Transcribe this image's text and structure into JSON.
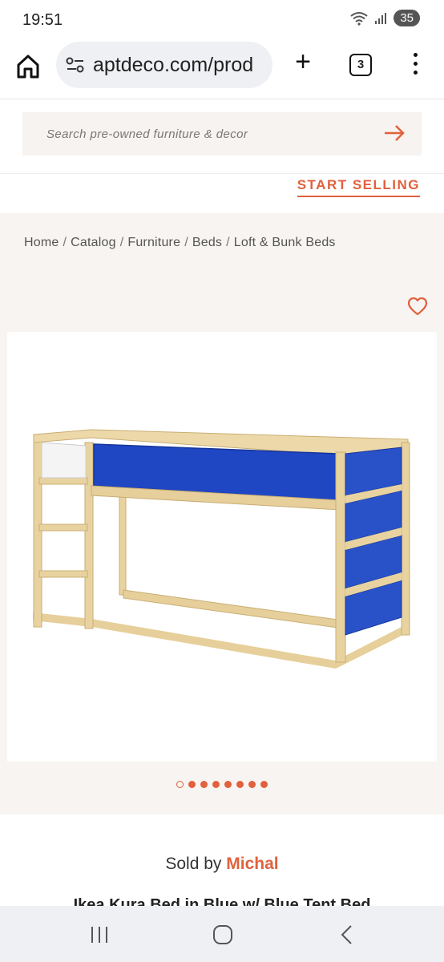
{
  "status_bar": {
    "time": "19:51",
    "battery": "35",
    "icons": [
      "wifi-icon",
      "signal-icon",
      "battery-icon"
    ]
  },
  "browser": {
    "url": "aptdeco.com/prod",
    "tab_count": "3",
    "icons": [
      "home-icon",
      "site-settings-icon",
      "plus-icon",
      "tabs-icon",
      "more-vert-icon"
    ]
  },
  "site": {
    "search_placeholder": "Search pre-owned furniture & decor",
    "start_selling": "START SELLING",
    "accent_color": "#e0613d"
  },
  "breadcrumb": {
    "items": [
      "Home",
      "Catalog",
      "Furniture",
      "Beds",
      "Loft & Bunk Beds"
    ],
    "separator": "/"
  },
  "gallery": {
    "total_images": 8,
    "active_index": 0
  },
  "product": {
    "sold_by_label": "Sold by",
    "seller_name": "Michal",
    "title_partial": "Ikea Kura Bed in Blue w/ Blue Tent Bed"
  },
  "android_nav": {
    "icons": [
      "recents-icon",
      "home-circle-icon",
      "back-icon"
    ]
  }
}
